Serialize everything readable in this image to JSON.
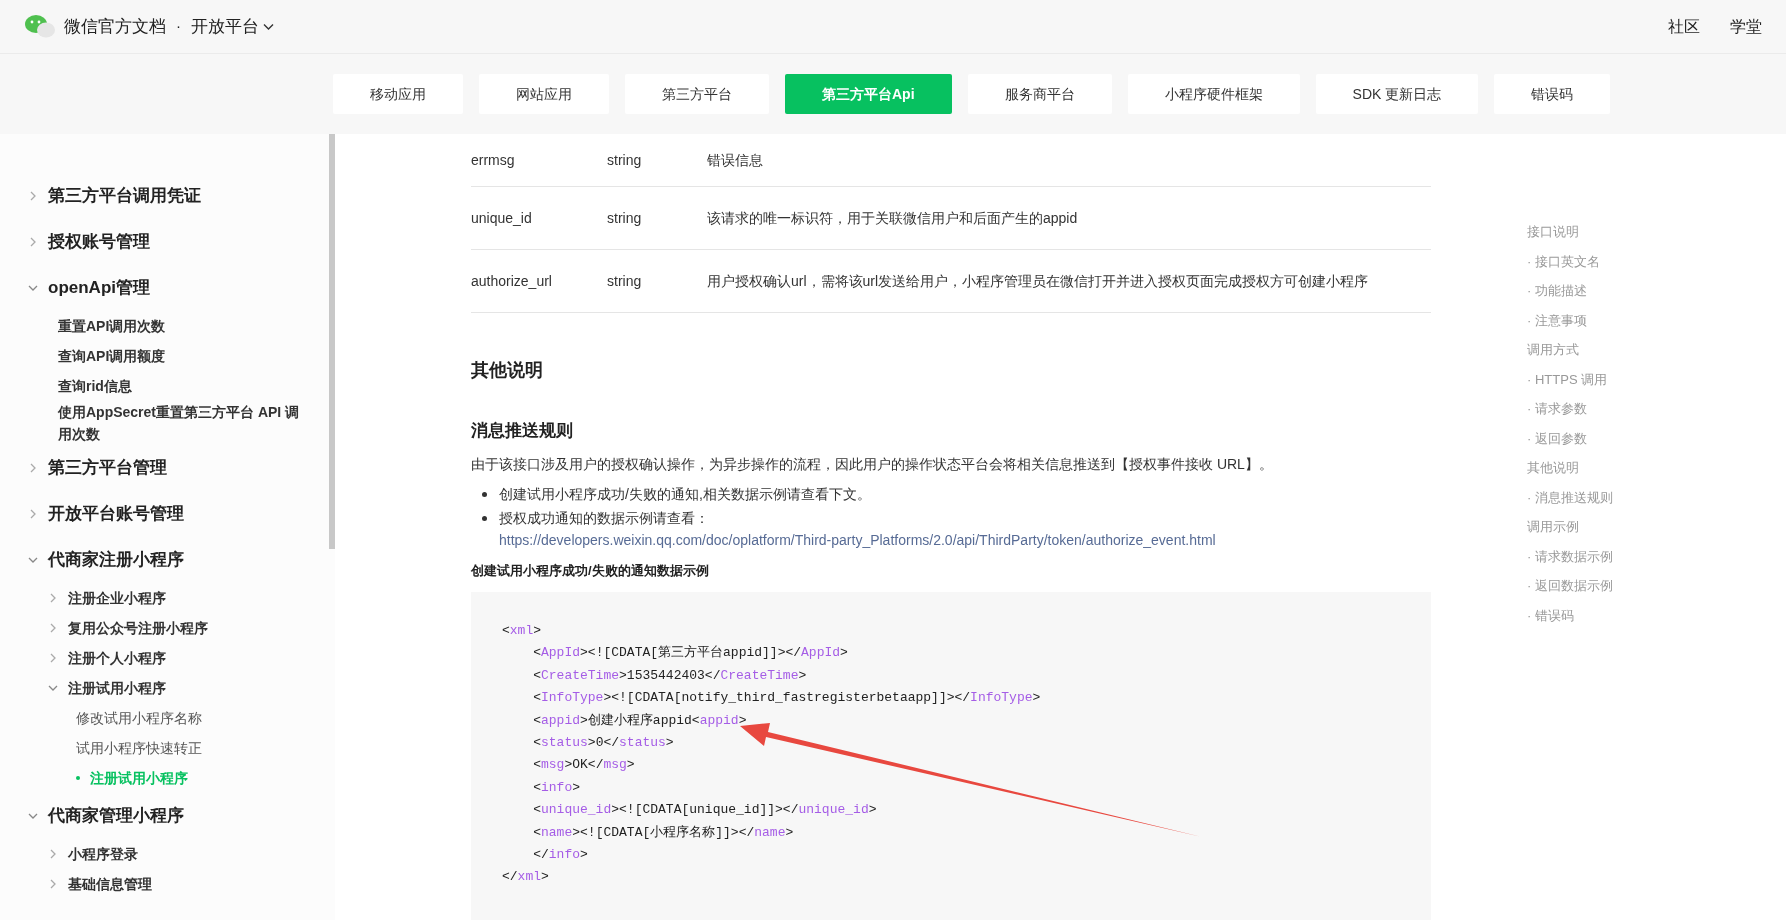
{
  "header": {
    "site_title": "微信官方文档",
    "separator": "·",
    "section": "开放平台",
    "links": [
      "社区",
      "学堂"
    ]
  },
  "tabs": [
    {
      "label": "移动应用",
      "selected": false
    },
    {
      "label": "网站应用",
      "selected": false
    },
    {
      "label": "第三方平台",
      "selected": false
    },
    {
      "label": "第三方平台Api",
      "selected": true
    },
    {
      "label": "服务商平台",
      "selected": false
    },
    {
      "label": "小程序硬件框架",
      "selected": false
    },
    {
      "label": "SDK 更新日志",
      "selected": false
    },
    {
      "label": "错误码",
      "selected": false
    }
  ],
  "sidebar": {
    "items": [
      {
        "label": "第三方平台调用凭证",
        "expanded": false,
        "selected": false
      },
      {
        "label": "授权账号管理",
        "expanded": false,
        "selected": false
      },
      {
        "label": "openApi管理",
        "expanded": true,
        "selected": false,
        "children": [
          {
            "label": "重置API调用次数",
            "selected": false
          },
          {
            "label": "查询API调用额度",
            "selected": false
          },
          {
            "label": "查询rid信息",
            "selected": false
          },
          {
            "label": "使用AppSecret重置第三方平台 API 调用次数",
            "selected": false
          }
        ]
      },
      {
        "label": "第三方平台管理",
        "expanded": false,
        "selected": false
      },
      {
        "label": "开放平台账号管理",
        "expanded": false,
        "selected": false
      },
      {
        "label": "代商家注册小程序",
        "expanded": true,
        "selected": false,
        "children": [
          {
            "label": "注册企业小程序",
            "expanded": false,
            "selected": false
          },
          {
            "label": "复用公众号注册小程序",
            "expanded": false,
            "selected": false
          },
          {
            "label": "注册个人小程序",
            "expanded": false,
            "selected": false
          },
          {
            "label": "注册试用小程序",
            "expanded": true,
            "selected": false,
            "children": [
              {
                "label": "修改试用小程序名称",
                "selected": false
              },
              {
                "label": "试用小程序快速转正",
                "selected": false
              },
              {
                "label": "注册试用小程序",
                "selected": true
              }
            ]
          }
        ]
      },
      {
        "label": "代商家管理小程序",
        "expanded": true,
        "selected": false,
        "children": [
          {
            "label": "小程序登录",
            "expanded": false,
            "selected": false
          },
          {
            "label": "基础信息管理",
            "expanded": false,
            "selected": false
          }
        ]
      }
    ]
  },
  "table": {
    "rows": [
      [
        "errmsg",
        "string",
        "错误信息"
      ],
      [
        "unique_id",
        "string",
        "该请求的唯一标识符，用于关联微信用户和后面产生的appid"
      ],
      [
        "authorize_url",
        "string",
        "用户授权确认url，需将该url发送给用户，小程序管理员在微信打开并进入授权页面完成授权方可创建小程序"
      ]
    ]
  },
  "section_title": "其他说明",
  "subsection_title": "消息推送规则",
  "paragraph": "由于该接口涉及用户的授权确认操作，为异步操作的流程，因此用户的操作状态平台会将相关信息推送到【授权事件接收 URL】。",
  "bullets": [
    {
      "text": "创建试用小程序成功/失败的通知,相关数据示例请查看下文。"
    },
    {
      "text": "授权成功通知的数据示例请查看：",
      "link": "https://developers.weixin.qq.com/doc/oplatform/Third-party_Platforms/2.0/api/ThirdParty/token/authorize_event.html"
    }
  ],
  "example_title": "创建试用小程序成功/失败的通知数据示例",
  "code_lines": [
    [
      {
        "kind": "p",
        "text": "<"
      },
      {
        "kind": "tag",
        "text": "xml"
      },
      {
        "kind": "p",
        "text": ">"
      }
    ],
    [
      {
        "kind": "p",
        "text": "    <"
      },
      {
        "kind": "tag",
        "text": "AppId"
      },
      {
        "kind": "p",
        "text": "><![CDATA[第三方平台appid]]></"
      },
      {
        "kind": "tag",
        "text": "AppId"
      },
      {
        "kind": "p",
        "text": ">"
      }
    ],
    [
      {
        "kind": "p",
        "text": "    <"
      },
      {
        "kind": "tag",
        "text": "CreateTime"
      },
      {
        "kind": "p",
        "text": ">1535442403</"
      },
      {
        "kind": "tag",
        "text": "CreateTime"
      },
      {
        "kind": "p",
        "text": ">"
      }
    ],
    [
      {
        "kind": "p",
        "text": "    <"
      },
      {
        "kind": "tag",
        "text": "InfoType"
      },
      {
        "kind": "p",
        "text": "><![CDATA[notify_third_fastregisterbetaapp]]></"
      },
      {
        "kind": "tag",
        "text": "InfoType"
      },
      {
        "kind": "p",
        "text": ">"
      }
    ],
    [
      {
        "kind": "p",
        "text": "    <"
      },
      {
        "kind": "tag",
        "text": "appid"
      },
      {
        "kind": "p",
        "text": ">创建小程序appid<"
      },
      {
        "kind": "tag",
        "text": "appid"
      },
      {
        "kind": "p",
        "text": ">"
      }
    ],
    [
      {
        "kind": "p",
        "text": "    <"
      },
      {
        "kind": "tag",
        "text": "status"
      },
      {
        "kind": "p",
        "text": ">0</"
      },
      {
        "kind": "tag",
        "text": "status"
      },
      {
        "kind": "p",
        "text": ">"
      }
    ],
    [
      {
        "kind": "p",
        "text": "    <"
      },
      {
        "kind": "tag",
        "text": "msg"
      },
      {
        "kind": "p",
        "text": ">OK</"
      },
      {
        "kind": "tag",
        "text": "msg"
      },
      {
        "kind": "p",
        "text": ">"
      }
    ],
    [
      {
        "kind": "p",
        "text": "    <"
      },
      {
        "kind": "tag",
        "text": "info"
      },
      {
        "kind": "p",
        "text": ">"
      }
    ],
    [
      {
        "kind": "p",
        "text": "    <"
      },
      {
        "kind": "tag",
        "text": "unique_id"
      },
      {
        "kind": "p",
        "text": "><![CDATA[unique_id]]></"
      },
      {
        "kind": "tag",
        "text": "unique_id"
      },
      {
        "kind": "p",
        "text": ">"
      }
    ],
    [
      {
        "kind": "p",
        "text": "    <"
      },
      {
        "kind": "tag",
        "text": "name"
      },
      {
        "kind": "p",
        "text": "><![CDATA[小程序名称]]></"
      },
      {
        "kind": "tag",
        "text": "name"
      },
      {
        "kind": "p",
        "text": ">"
      }
    ],
    [
      {
        "kind": "p",
        "text": "    </"
      },
      {
        "kind": "tag",
        "text": "info"
      },
      {
        "kind": "p",
        "text": ">"
      }
    ],
    [
      {
        "kind": "p",
        "text": "</"
      },
      {
        "kind": "tag",
        "text": "xml"
      },
      {
        "kind": "p",
        "text": ">"
      }
    ]
  ],
  "toc": [
    "接口说明",
    "· 接口英文名",
    "· 功能描述",
    "· 注意事项",
    "调用方式",
    "· HTTPS 调用",
    "· 请求参数",
    "· 返回参数",
    "其他说明",
    "· 消息推送规则",
    "调用示例",
    "· 请求数据示例",
    "· 返回数据示例",
    "· 错误码"
  ]
}
